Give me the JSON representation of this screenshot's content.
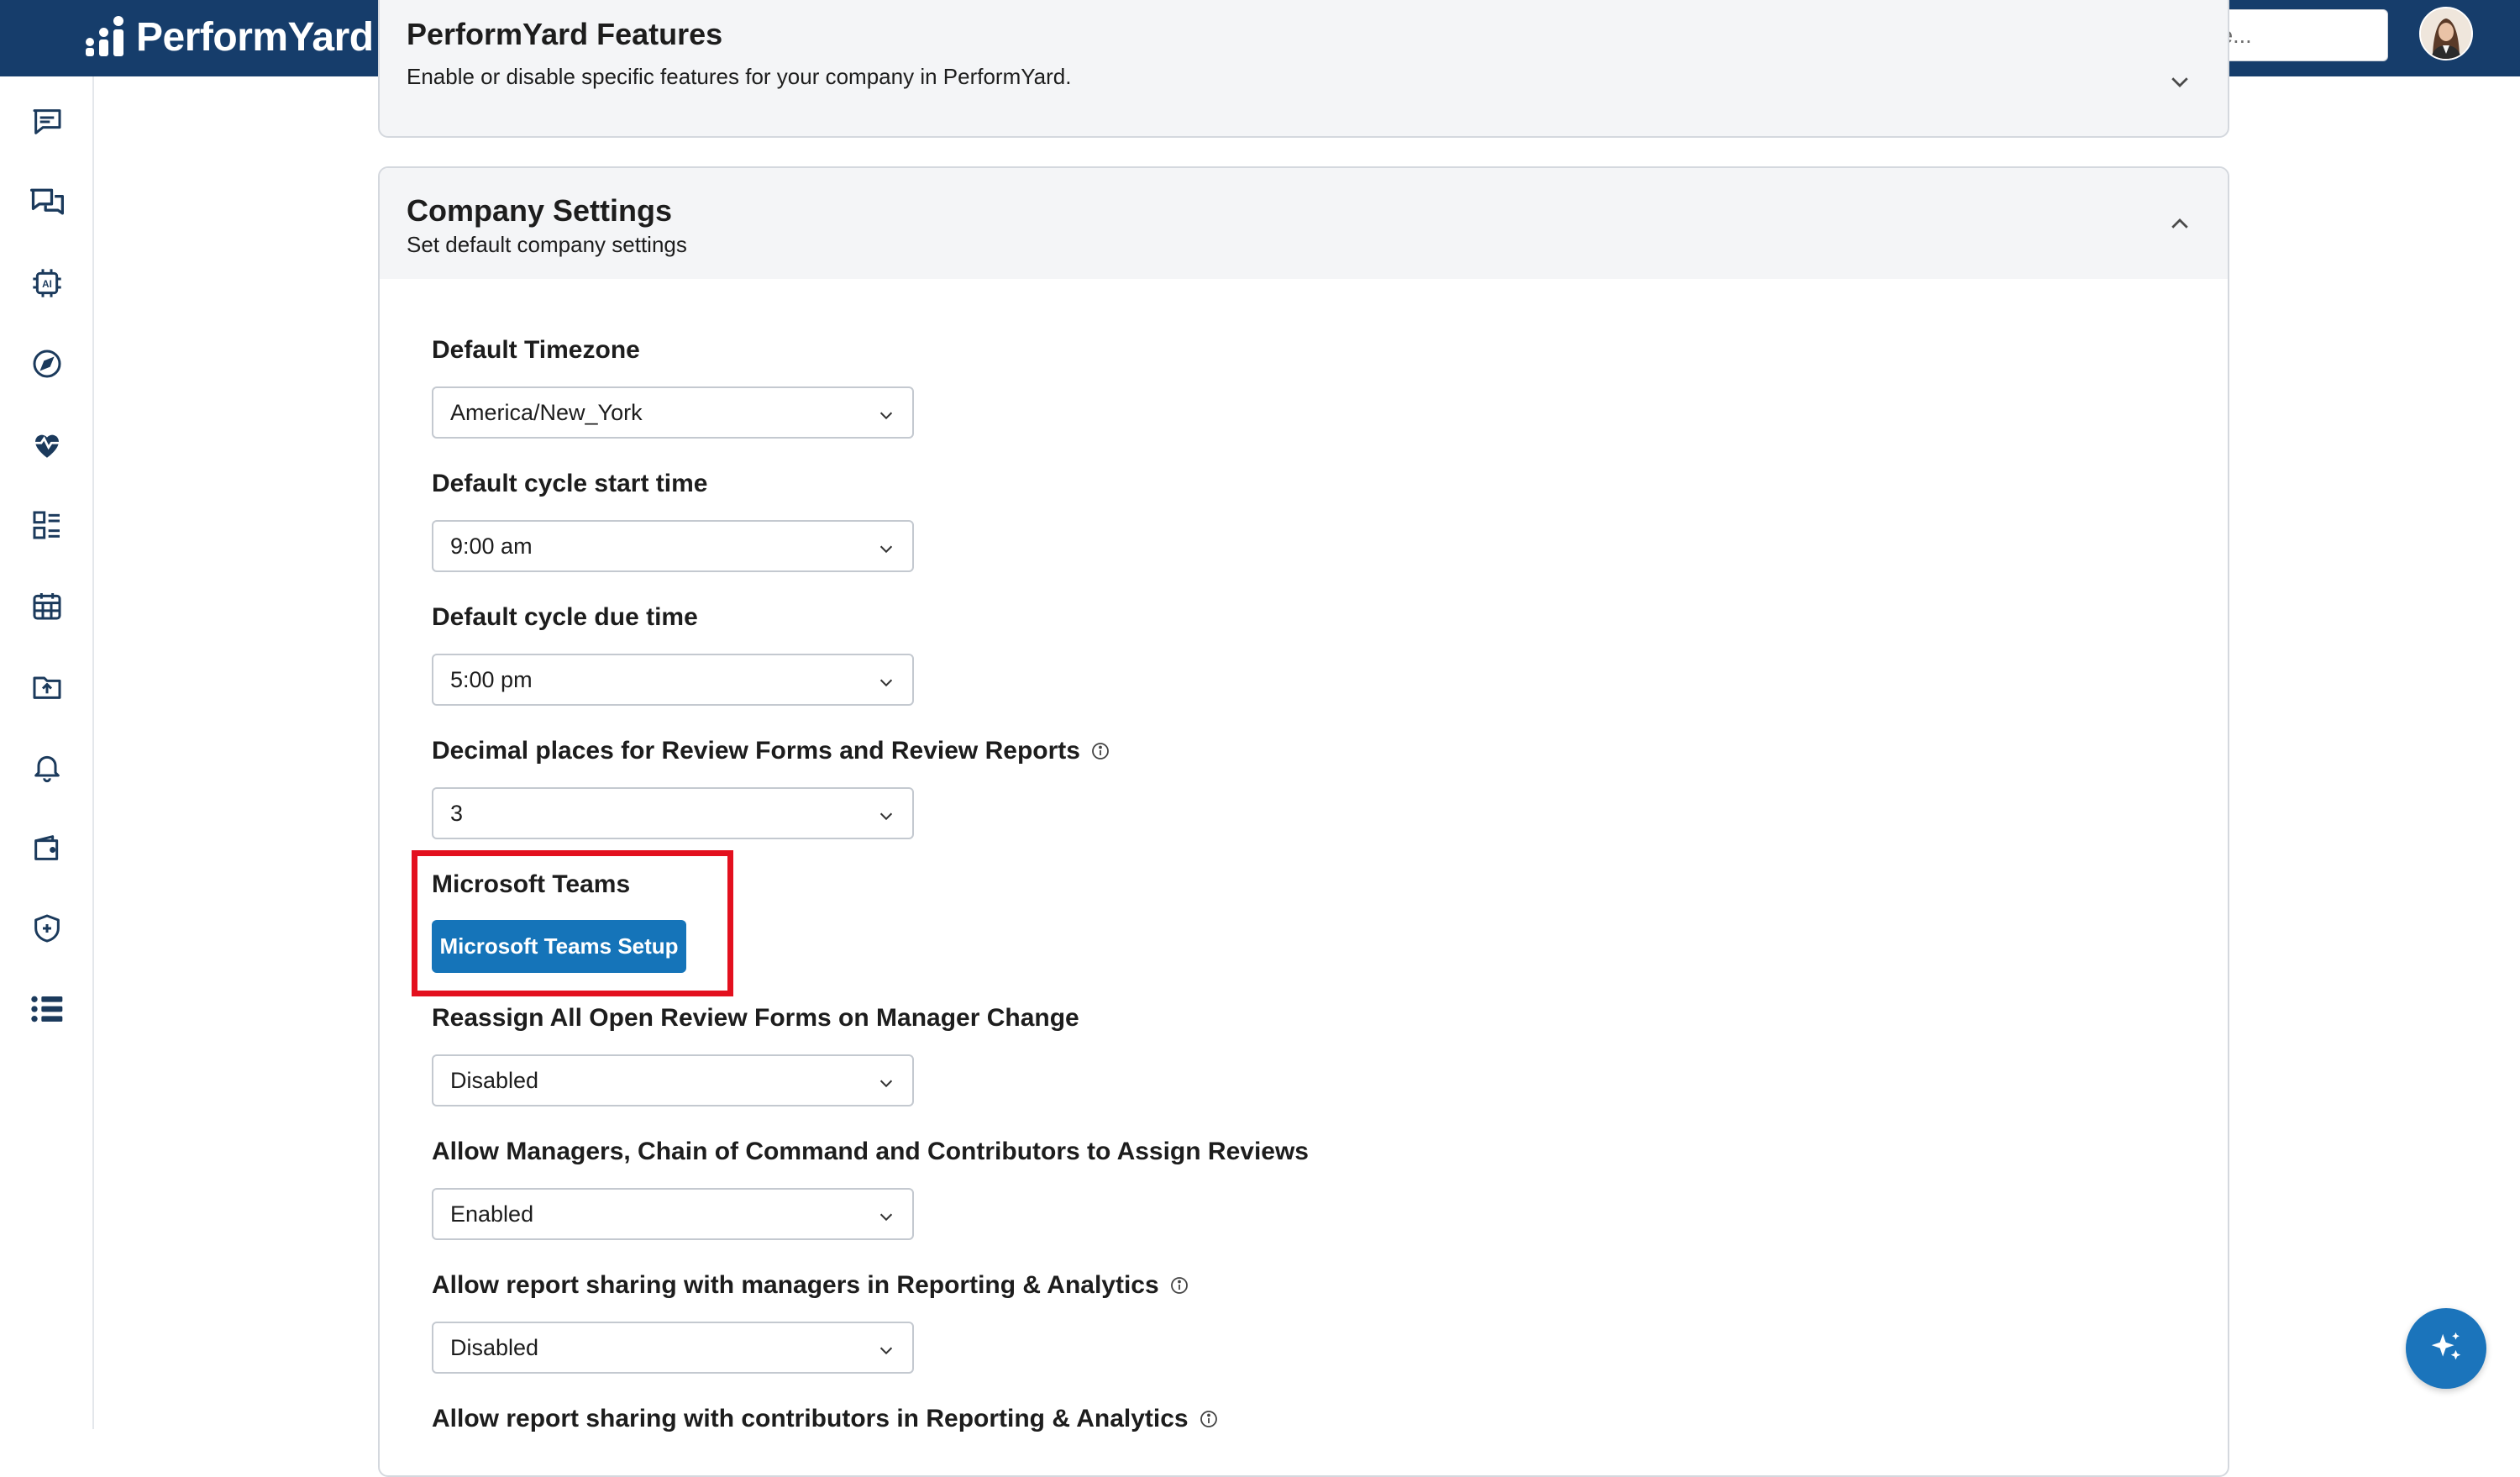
{
  "app": {
    "brand": "PerformYard",
    "brand_color": "#163d6b",
    "accent_color": "#1574b9"
  },
  "header": {
    "search_placeholder": "Search employee..."
  },
  "rail": {
    "icons": [
      "feedback-icon",
      "conversations-icon",
      "ai-chip-icon",
      "compass-icon",
      "heart-pulse-icon",
      "dashboard-icon",
      "calendar-icon",
      "folder-upload-icon",
      "bell-icon",
      "wallet-icon",
      "shield-plus-icon",
      "list-icon"
    ]
  },
  "sections": {
    "features": {
      "title": "PerformYard Features",
      "subtitle": "Enable or disable specific features for your company in PerformYard."
    },
    "company": {
      "title": "Company Settings",
      "subtitle": "Set default company settings"
    }
  },
  "fields": {
    "timezone": {
      "label": "Default Timezone",
      "value": "America/New_York"
    },
    "cycle_start": {
      "label": "Default cycle start time",
      "value": "9:00 am"
    },
    "cycle_due": {
      "label": "Default cycle due time",
      "value": "5:00 pm"
    },
    "decimal_places": {
      "label": "Decimal places for Review Forms and Review Reports",
      "value": "3"
    },
    "teams": {
      "label": "Microsoft Teams",
      "button": "Microsoft Teams Setup"
    },
    "reassign": {
      "label": "Reassign All Open Review Forms on Manager Change",
      "value": "Disabled"
    },
    "assign_reviews": {
      "label": "Allow Managers, Chain of Command and Contributors to Assign Reviews",
      "value": "Enabled"
    },
    "share_managers": {
      "label": "Allow report sharing with managers in Reporting & Analytics",
      "value": "Disabled"
    },
    "share_contributors": {
      "label": "Allow report sharing with contributors in Reporting & Analytics"
    }
  }
}
